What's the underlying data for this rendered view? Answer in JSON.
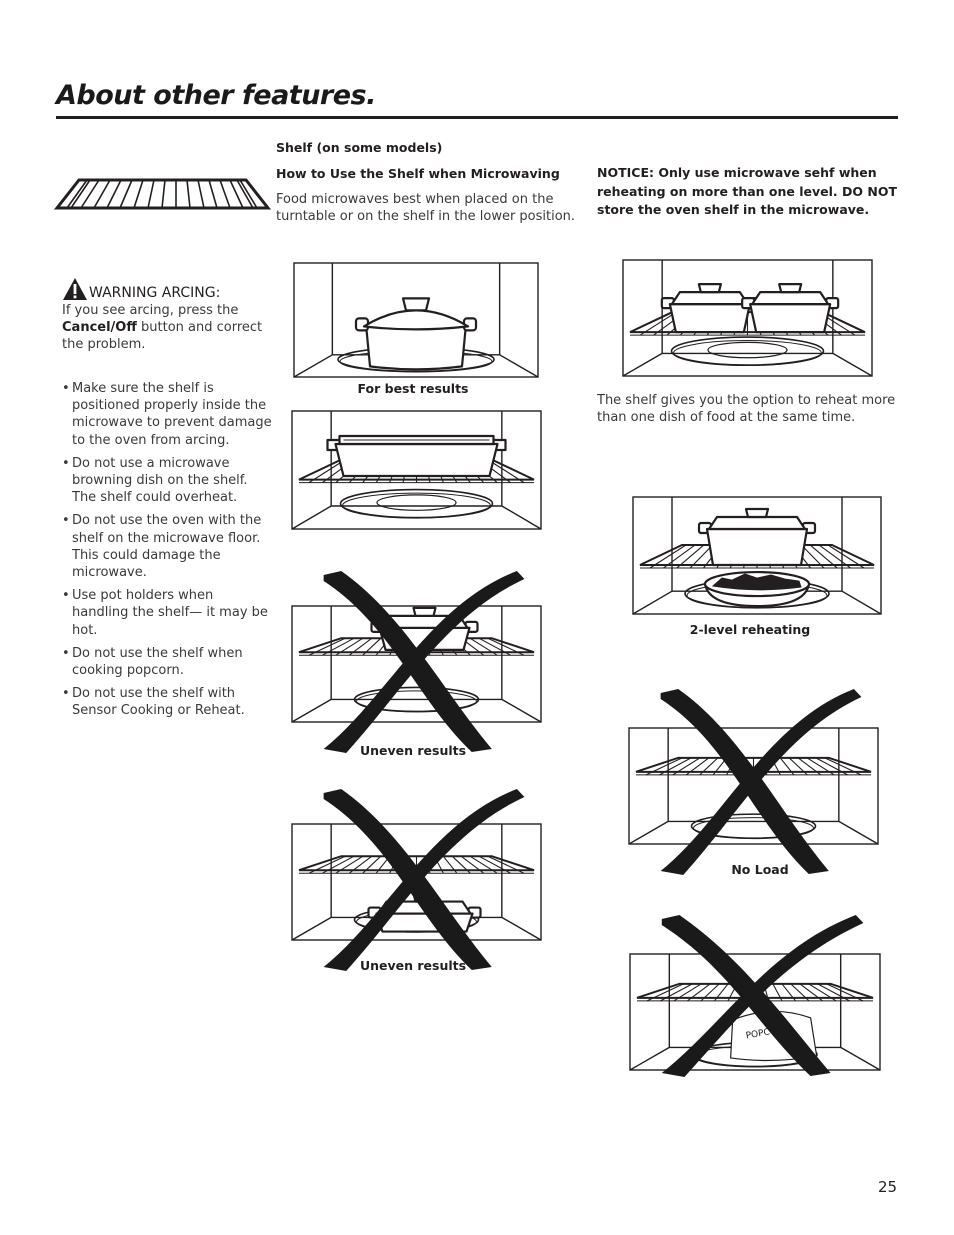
{
  "page": {
    "title": "About other features.",
    "page_number": "25"
  },
  "shelf_section": {
    "heading": "Shelf (on some models)",
    "subheading": "How to Use the Shelf when Microwaving",
    "description": "Food microwaves best when placed on the turntable or on the shelf in the lower position.",
    "notice": "NOTICE:  Only use microwave sehf when reheating on more than one level.  DO NOT store the oven shelf in the microwave.",
    "option_text": "The shelf gives you the option to reheat more than one dish of food at the same time."
  },
  "warning": {
    "icon": "warning-triangle-icon",
    "title": "WARNING ARCING:",
    "text_before": "If you see arcing, press the ",
    "button_name": "Cancel/Off",
    "text_after": " button and correct the problem."
  },
  "bullets": [
    "Make sure the shelf is positioned properly inside the microwave to prevent damage to the oven from arcing.",
    "Do not use a microwave browning dish on the shelf. The shelf could overheat.",
    "Do not use the oven with the shelf on the microwave floor. This could damage the microwave.",
    "Use pot holders when handling the shelf— it may be hot.",
    "Do not use the shelf when cooking popcorn.",
    "Do not use the shelf with Sensor Cooking or Reheat."
  ],
  "figures": {
    "best_results": "For best results",
    "uneven_1": "Uneven results",
    "uneven_2": "Uneven results",
    "two_level": "2-level reheating",
    "no_load": "No Load",
    "popcorn_label": "POPCORN"
  }
}
